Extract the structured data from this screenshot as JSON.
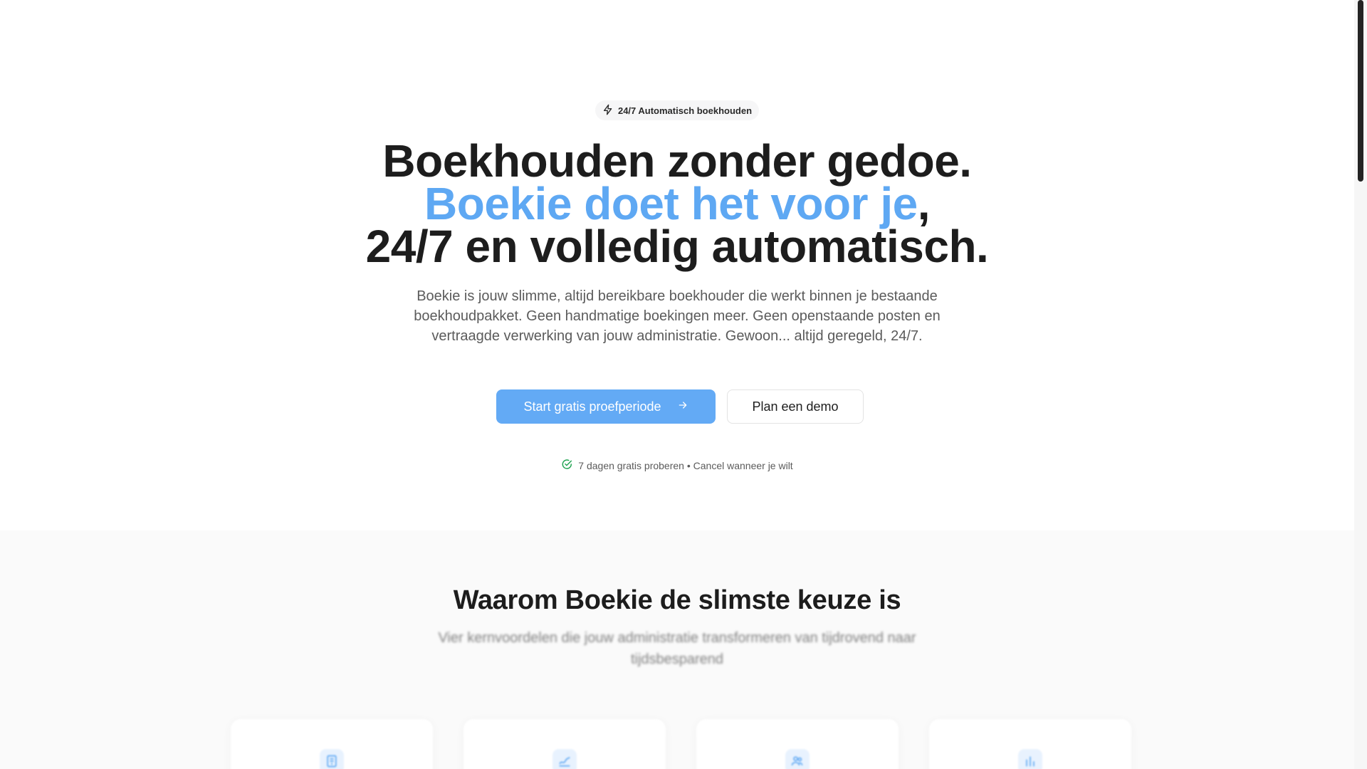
{
  "hero": {
    "badge_label": "24/7 Automatisch boekhouden",
    "headline_line1": "Boekhouden zonder gedoe.",
    "headline_accent": "Boekie doet het voor je",
    "headline_comma": ",",
    "headline_line3": "24/7 en volledig automatisch.",
    "subtext": "Boekie is jouw slimme, altijd bereikbare boekhouder die werkt binnen je bestaande boekhoudpakket. Geen handmatige boekingen meer. Geen openstaande posten en vertraagde verwerking van jouw administratie. Gewoon... altijd geregeld, 24/7.",
    "primary_cta": "Start gratis proefperiode",
    "secondary_cta": "Plan een demo",
    "trial_note": "7 dagen gratis proberen • Cancel wanneer je wilt"
  },
  "features": {
    "title": "Waarom Boekie de slimste keuze is",
    "subtitle": "Vier kernvoordelen die jouw administratie transformeren van tijdrovend naar tijdsbesparend",
    "cards": [
      {
        "icon": "receipt-icon"
      },
      {
        "icon": "trend-icon"
      },
      {
        "icon": "users-icon"
      },
      {
        "icon": "bar-chart-icon"
      }
    ]
  },
  "colors": {
    "accent": "#5ea8f3",
    "primary_button": "#63aaf5",
    "success": "#22a352",
    "text": "#1d1d1d",
    "muted": "#5b5b5b"
  }
}
